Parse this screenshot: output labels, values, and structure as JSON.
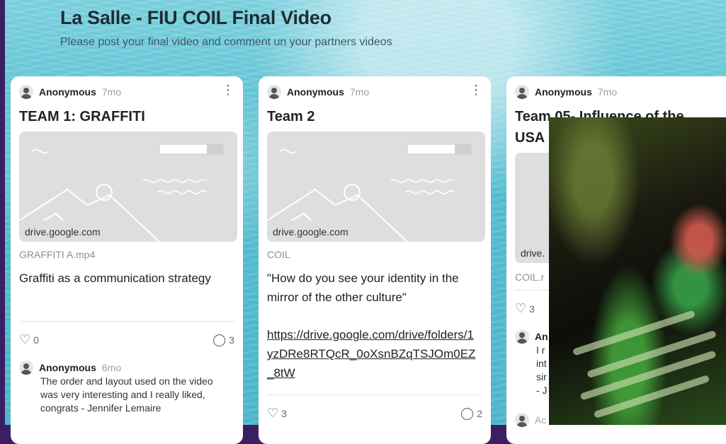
{
  "board": {
    "title": "La Salle - FIU COIL Final Video",
    "subtitle": "Please post your final video and comment un your partners videos"
  },
  "posts": [
    {
      "author": "Anonymous",
      "time": "7mo",
      "title": "TEAM 1: GRAFFITI",
      "link_domain": "drive.google.com",
      "attachment": "GRAFFITI A.mp4",
      "body": "Graffiti as a communication strategy",
      "likes": "0",
      "comments": "3",
      "comment": {
        "author": "Anonymous",
        "time": "6mo",
        "text": "The order and layout used on the video was very interesting and I really liked, congrats - Jennifer Lemaire"
      }
    },
    {
      "author": "Anonymous",
      "time": "7mo",
      "title": "Team 2",
      "link_domain": "drive.google.com",
      "attachment": "COIL",
      "body": "\"How do you see your identity in the mirror of the other culture\"",
      "link": "https://drive.google.com/drive/folders/1yzDRe8RTQcR_0oXsnBZqTSJOm0EZ_8tW",
      "likes": "3",
      "comments": "2"
    },
    {
      "author": "Anonymous",
      "time": "7mo",
      "title_line1": "Team 05- Influence of the",
      "title_line2": "USA",
      "link_domain": "drive.",
      "attachment": "COIL.r",
      "likes": "3",
      "comment": {
        "author": "An",
        "text": "I r\nint\nsir\n- J"
      },
      "next_comment_author": "Ac"
    }
  ],
  "icons": {
    "more": "more-vertical-icon",
    "like": "heart-icon",
    "comment": "comment-icon",
    "avatar": "avatar-icon"
  },
  "colors": {
    "background": "#57bfd2",
    "card": "#ffffff",
    "outer_frame": "#3a1f63"
  }
}
